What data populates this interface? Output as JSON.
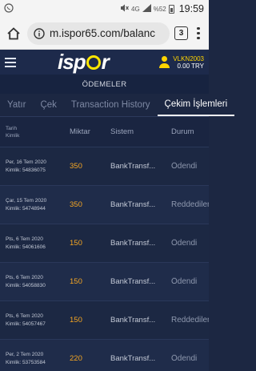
{
  "statusbar": {
    "network": "4G",
    "battery": "%52",
    "time": "19:59"
  },
  "browser": {
    "url": "m.ispor65.com/balanc",
    "tab_count": "3"
  },
  "header": {
    "logo_pre": "i",
    "logo_s": "s",
    "logo_p": "p",
    "logo_r": "r",
    "username": "VLKN2003",
    "balance": "0.00 TRY"
  },
  "page": {
    "title": "ÖDEMELER"
  },
  "tabs": [
    {
      "label": "Yatır"
    },
    {
      "label": "Çek"
    },
    {
      "label": "Transaction History"
    },
    {
      "label": "Çekim İşlemleri"
    }
  ],
  "table": {
    "col_date": "Tarih",
    "col_id": "Kimlik",
    "col_amount": "Miktar",
    "col_system": "Sistem",
    "col_status": "Durum",
    "rows": [
      {
        "date": "Per, 16 Tem 2020",
        "id": "Kimlik: 54836075",
        "amount": "350",
        "system": "BankTransf...",
        "status": "Ödendi"
      },
      {
        "date": "Çar, 15 Tem 2020",
        "id": "Kimlik: 54748944",
        "amount": "350",
        "system": "BankTransf...",
        "status": "Reddedilen"
      },
      {
        "date": "Pts, 6 Tem 2020",
        "id": "Kimlik: 54061606",
        "amount": "150",
        "system": "BankTransf...",
        "status": "Ödendi"
      },
      {
        "date": "Pts, 6 Tem 2020",
        "id": "Kimlik: 54058830",
        "amount": "150",
        "system": "BankTransf...",
        "status": "Ödendi"
      },
      {
        "date": "Pts, 6 Tem 2020",
        "id": "Kimlik: 54057467",
        "amount": "150",
        "system": "BankTransf...",
        "status": "Reddedilen"
      },
      {
        "date": "Per, 2 Tem 2020",
        "id": "Kimlik: 53753584",
        "amount": "220",
        "system": "BankTransf...",
        "status": "Ödendi"
      }
    ]
  }
}
